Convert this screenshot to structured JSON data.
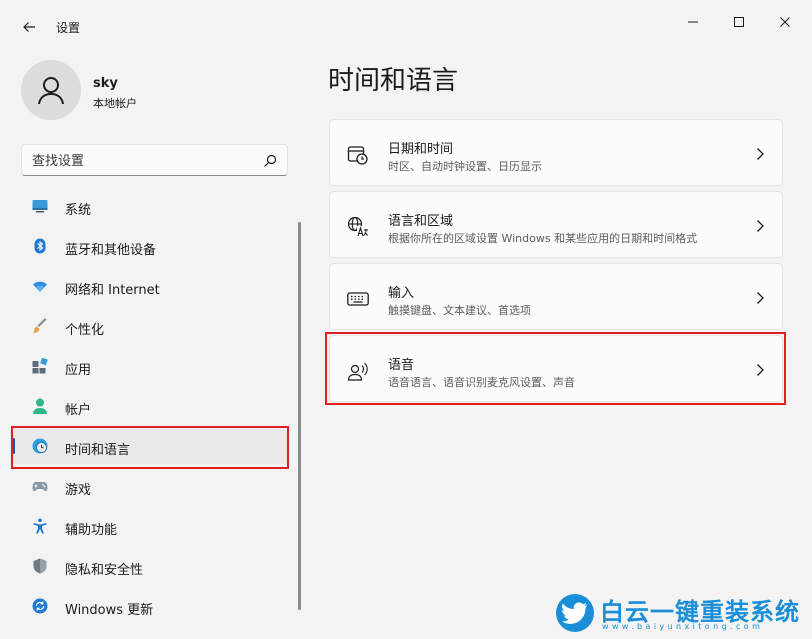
{
  "window": {
    "title": "设置",
    "icons": {
      "back": "back-arrow-icon",
      "minimize": "minimize-icon",
      "maximize": "maximize-icon",
      "close": "close-icon"
    }
  },
  "user": {
    "name": "sky",
    "account_type": "本地帐户"
  },
  "search": {
    "placeholder": "查找设置"
  },
  "nav": {
    "items": [
      {
        "label": "系统",
        "icon": "system-icon"
      },
      {
        "label": "蓝牙和其他设备",
        "icon": "bluetooth-icon"
      },
      {
        "label": "网络和 Internet",
        "icon": "wifi-icon"
      },
      {
        "label": "个性化",
        "icon": "brush-icon"
      },
      {
        "label": "应用",
        "icon": "apps-icon"
      },
      {
        "label": "帐户",
        "icon": "account-icon"
      },
      {
        "label": "时间和语言",
        "icon": "time-language-icon",
        "selected": true
      },
      {
        "label": "游戏",
        "icon": "gamepad-icon"
      },
      {
        "label": "辅助功能",
        "icon": "accessibility-icon"
      },
      {
        "label": "隐私和安全性",
        "icon": "shield-icon"
      },
      {
        "label": "Windows 更新",
        "icon": "update-icon"
      }
    ]
  },
  "main": {
    "title": "时间和语言",
    "cards": [
      {
        "title": "日期和时间",
        "subtitle": "时区、自动时钟设置、日历显示",
        "icon": "calendar-clock-icon"
      },
      {
        "title": "语言和区域",
        "subtitle": "根据你所在的区域设置 Windows 和某些应用的日期和时间格式",
        "icon": "language-region-icon"
      },
      {
        "title": "输入",
        "subtitle": "触摸键盘、文本建议、首选项",
        "icon": "keyboard-icon"
      },
      {
        "title": "语音",
        "subtitle": "语音语言、语音识别麦克风设置、声音",
        "icon": "speech-icon"
      }
    ]
  },
  "watermark": {
    "text": "白云一键重装系统",
    "url": "www.baiyunxitong.com",
    "color": "#1a8fd8"
  },
  "colors": {
    "accent": "#005fb8",
    "highlight": "#e02020",
    "background": "#f3f3f3"
  }
}
